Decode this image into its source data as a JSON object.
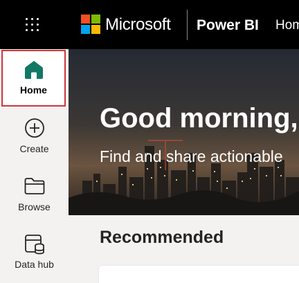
{
  "header": {
    "brand": "Microsoft",
    "app": "Power BI",
    "breadcrumb": "Home",
    "logo_colors": [
      "#f25022",
      "#7fba00",
      "#00a4ef",
      "#ffb900"
    ]
  },
  "nav": {
    "items": [
      {
        "label": "Home",
        "icon": "home-icon",
        "active": true
      },
      {
        "label": "Create",
        "icon": "plus-circle-icon"
      },
      {
        "label": "Browse",
        "icon": "folder-icon"
      },
      {
        "label": "Data hub",
        "icon": "data-hub-icon"
      }
    ]
  },
  "hero": {
    "greeting": "Good morning,",
    "subtitle": "Find and share actionable"
  },
  "sections": {
    "recommended": "Recommended"
  },
  "colors": {
    "accent": "#117865",
    "selection_border": "#d13438"
  }
}
